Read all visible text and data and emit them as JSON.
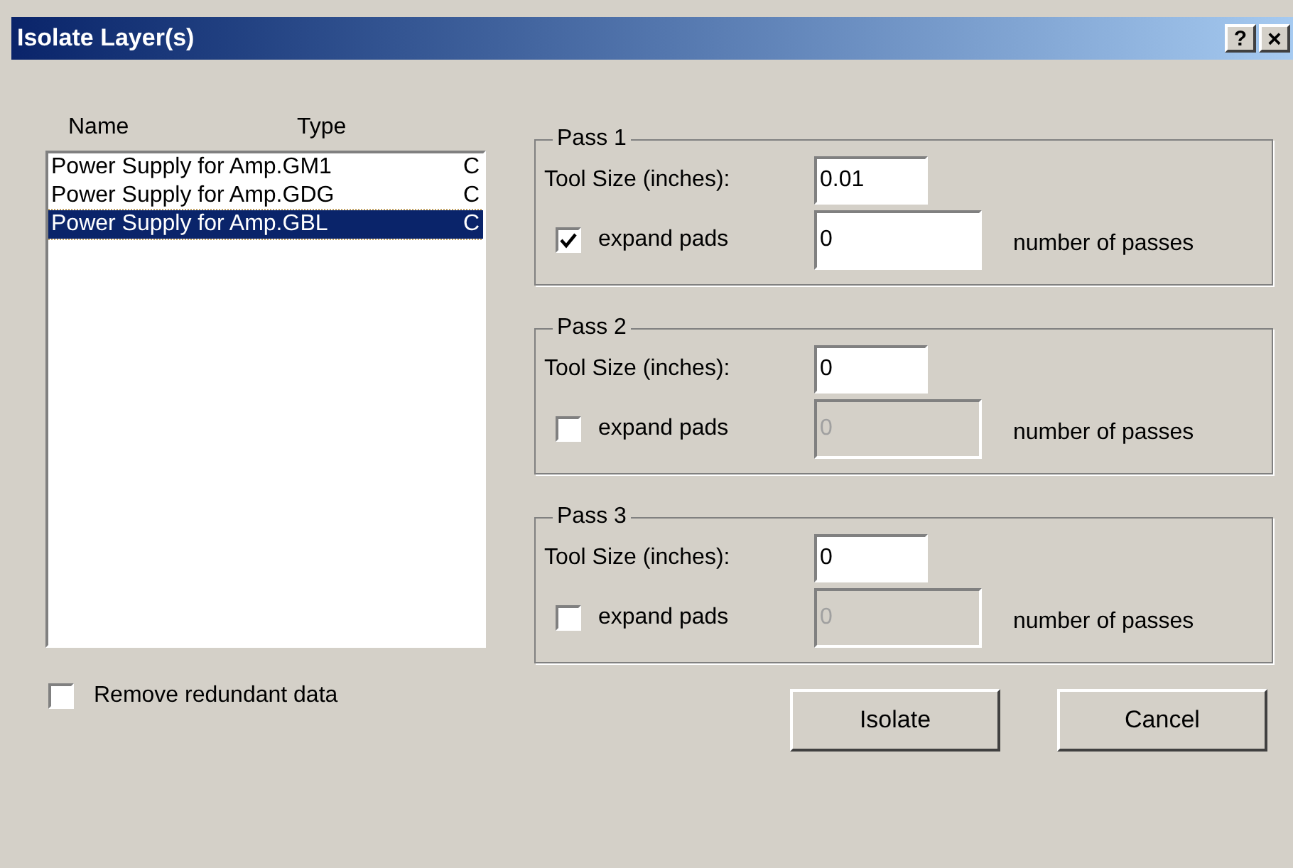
{
  "window": {
    "title": "Isolate Layer(s)",
    "help_button": "?",
    "close_button": "×"
  },
  "layer_list": {
    "columns": [
      "Name",
      "Type"
    ],
    "rows": [
      {
        "name": "Power Supply for Amp.GM1",
        "type": "C",
        "selected": false
      },
      {
        "name": "Power Supply for Amp.GDG",
        "type": "C",
        "selected": false
      },
      {
        "name": "Power Supply for Amp.GBL",
        "type": "C",
        "selected": true
      }
    ]
  },
  "remove_redundant": {
    "label": "Remove redundant data",
    "checked": false
  },
  "passes": [
    {
      "title": "Pass 1",
      "tool_size_label": "Tool Size (inches):",
      "tool_size": "0.01",
      "expand_label": "expand pads",
      "expand_checked": true,
      "passes_value": "0",
      "passes_disabled": false,
      "passes_label": "number of passes"
    },
    {
      "title": "Pass 2",
      "tool_size_label": "Tool Size (inches):",
      "tool_size": "0",
      "expand_label": "expand pads",
      "expand_checked": false,
      "passes_value": "0",
      "passes_disabled": true,
      "passes_label": "number of passes"
    },
    {
      "title": "Pass 3",
      "tool_size_label": "Tool Size (inches):",
      "tool_size": "0",
      "expand_label": "expand pads",
      "expand_checked": false,
      "passes_value": "0",
      "passes_disabled": true,
      "passes_label": "number of passes"
    }
  ],
  "buttons": [
    "Isolate",
    "Cancel"
  ]
}
